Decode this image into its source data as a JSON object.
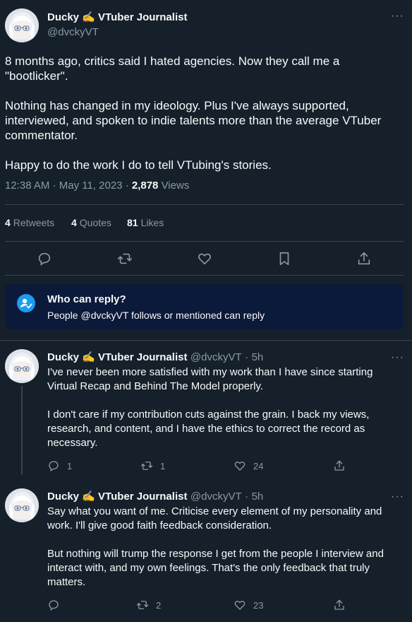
{
  "tweet": {
    "display_name": "Ducky ✍️ VTuber Journalist",
    "handle": "@dvckyVT",
    "paragraphs": [
      "8 months ago, critics said I hated agencies. Now they call me a \"bootlicker\".",
      "Nothing has changed in my ideology. Plus I've always supported, interviewed, and spoken to indie talents more than the average VTuber commentator.",
      "Happy to do the work I do to tell VTubing's stories."
    ],
    "time": "12:38 AM",
    "date": "May 11, 2023",
    "views_count": "2,878",
    "views_label": "Views",
    "retweets_count": "4",
    "retweets_label": "Retweets",
    "quotes_count": "4",
    "quotes_label": "Quotes",
    "likes_count": "81",
    "likes_label": "Likes"
  },
  "reply_notice": {
    "title": "Who can reply?",
    "body": "People @dvckyVT follows or mentioned can reply"
  },
  "replies": [
    {
      "display_name": "Ducky ✍️ VTuber Journalist",
      "handle": "@dvckyVT",
      "age": "5h",
      "paragraphs": [
        "I've never been more satisfied with my work than I have since starting Virtual Recap and Behind The Model properly.",
        "I don't care if my contribution cuts against the grain. I back my views, research, and content, and I have the ethics to correct the record as necessary."
      ],
      "replies_count": "1",
      "retweets_count": "1",
      "likes_count": "24"
    },
    {
      "display_name": "Ducky ✍️ VTuber Journalist",
      "handle": "@dvckyVT",
      "age": "5h",
      "paragraphs": [
        "Say what you want of me. Criticise every element of my personality and work. I'll give good faith feedback consideration.",
        "But nothing will trump the response I get from the people I interview and interact with, and my own feelings. That's the only feedback that truly matters."
      ],
      "replies_count": "",
      "retweets_count": "2",
      "likes_count": "23"
    }
  ],
  "icons": {
    "more": "more-horizontal-icon",
    "reply": "speech-bubble-icon",
    "retweet": "retweet-icon",
    "like": "heart-icon",
    "bookmark": "bookmark-icon",
    "share": "share-icon",
    "reply_settings": "people-check-icon"
  },
  "colors": {
    "background": "#15202b",
    "text": "#f7f9f9",
    "muted": "#8b98a5",
    "divider": "#38444d",
    "accent": "#1d9bf0",
    "notice_bg": "#0b1a3a"
  }
}
